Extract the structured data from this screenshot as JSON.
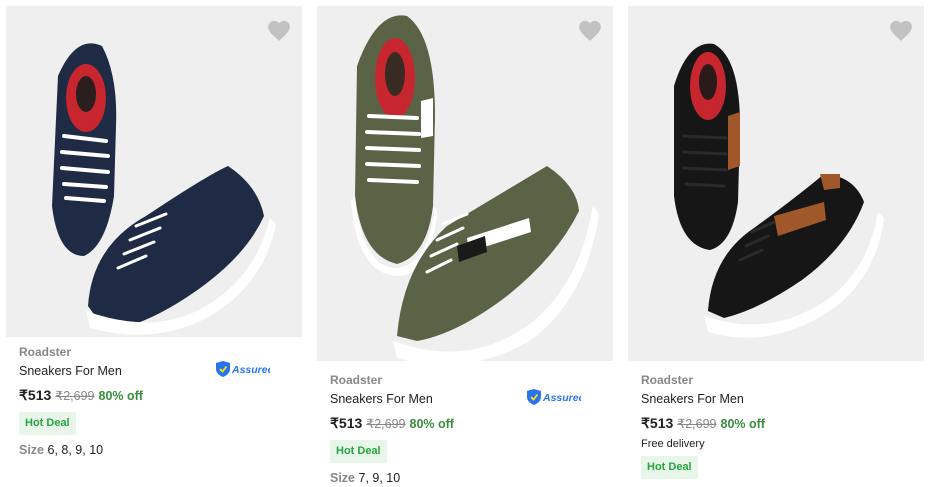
{
  "products": [
    {
      "brand": "Roadster",
      "title": "Sneakers For Men",
      "price": "₹513",
      "mrp": "₹2,699",
      "discount": "80% off",
      "hot_deal": "Hot Deal",
      "size_label": "Size",
      "sizes": "6, 8, 9, 10",
      "assured": "Assured",
      "shoe_color": "#1f2a44"
    },
    {
      "brand": "Roadster",
      "title": "Sneakers For Men",
      "price": "₹513",
      "mrp": "₹2,699",
      "discount": "80% off",
      "hot_deal": "Hot Deal",
      "size_label": "Size",
      "sizes": "7, 9, 10",
      "assured": "Assured",
      "shoe_color": "#5a6346"
    },
    {
      "brand": "Roadster",
      "title": "Sneakers For Men",
      "price": "₹513",
      "mrp": "₹2,699",
      "discount": "80% off",
      "delivery": "Free delivery",
      "hot_deal": "Hot Deal",
      "shoe_color": "#161616",
      "accent_color": "#a0582a"
    }
  ],
  "icons": {
    "wishlist": "heart-icon",
    "assured": "assured-badge-icon"
  },
  "colors": {
    "discount_green": "#388e3c",
    "hot_deal_bg": "#e8f5e9",
    "hot_deal_text": "#26a541",
    "assured_blue": "#2874f0",
    "heart_grey": "#c2c2c2"
  }
}
